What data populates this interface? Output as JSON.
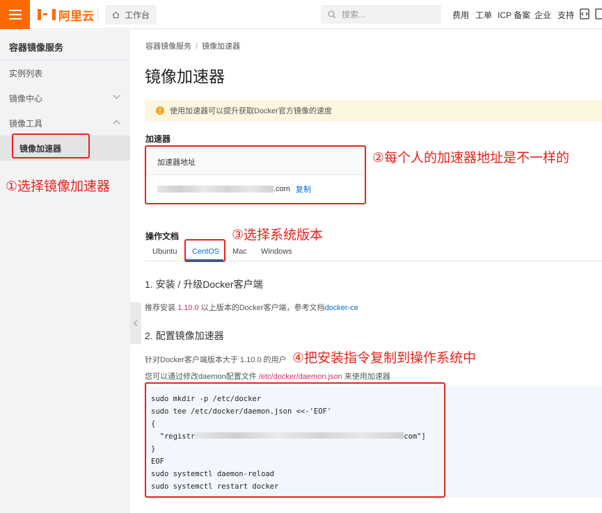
{
  "topbar": {
    "brand": "阿里云",
    "workbench": "工作台",
    "search_placeholder": "搜索...",
    "nav": [
      "费用",
      "工单",
      "ICP 备案",
      "企业",
      "支持"
    ]
  },
  "sidebar": {
    "title": "容器镜像服务",
    "items": [
      {
        "label": "实例列表"
      },
      {
        "label": "镜像中心"
      },
      {
        "label": "镜像工具"
      },
      {
        "label": "镜像加速器"
      }
    ]
  },
  "breadcrumb": {
    "root": "容器镜像服务",
    "sep": "/",
    "current": "镜像加速器"
  },
  "page_title": "镜像加速器",
  "notice": "使用加速器可以提升获取Docker官方镜像的速度",
  "accelerator": {
    "section_label": "加速器",
    "header": "加速器地址",
    "address_suffix": ".com",
    "copy_label": "复制"
  },
  "docs": {
    "section_label": "操作文档",
    "tabs": [
      "Ubuntu",
      "CentOS",
      "Mac",
      "Windows"
    ],
    "active_tab": "CentOS",
    "step1_title": "1. 安装 / 升级Docker客户端",
    "step1_text_pre": "推荐安装",
    "step1_version": "1.10.0",
    "step1_text_mid": "以上版本的Docker客户端，参考文档",
    "step1_link": "docker-ce",
    "step2_title": "2. 配置镜像加速器",
    "step2_text1": "针对Docker客户端版本大于 1.10.0 的用户",
    "step2_text2_pre": "您可以通过修改daemon配置文件",
    "step2_path": "/etc/docker/daemon.json",
    "step2_text2_post": "来使用加速器",
    "code_lines": [
      "sudo mkdir -p /etc/docker",
      "sudo tee /etc/docker/daemon.json <<-'EOF'",
      "{",
      "  \"registr",
      "com\"]",
      "}",
      "EOF",
      "sudo systemctl daemon-reload",
      "sudo systemctl restart docker"
    ]
  },
  "annotations": {
    "a1": "①选择镜像加速器",
    "a2": "②每个人的加速器地址是不一样的",
    "a3": "③选择系统版本",
    "a4": "④把安装指令复制到操作系统中"
  },
  "colors": {
    "brand": "#ff6a00",
    "link": "#0070cc",
    "annotation": "#e8211c"
  }
}
